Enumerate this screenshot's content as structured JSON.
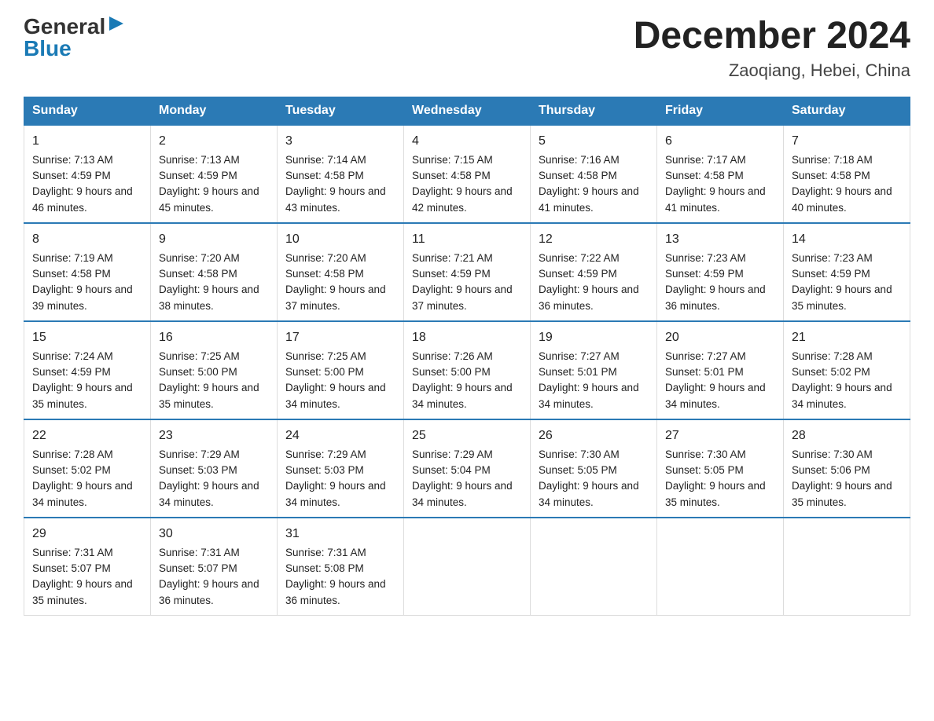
{
  "logo": {
    "general": "General",
    "blue": "Blue"
  },
  "title": "December 2024",
  "location": "Zaoqiang, Hebei, China",
  "weekdays": [
    "Sunday",
    "Monday",
    "Tuesday",
    "Wednesday",
    "Thursday",
    "Friday",
    "Saturday"
  ],
  "weeks": [
    [
      {
        "day": "1",
        "sunrise": "7:13 AM",
        "sunset": "4:59 PM",
        "daylight": "9 hours and 46 minutes."
      },
      {
        "day": "2",
        "sunrise": "7:13 AM",
        "sunset": "4:59 PM",
        "daylight": "9 hours and 45 minutes."
      },
      {
        "day": "3",
        "sunrise": "7:14 AM",
        "sunset": "4:58 PM",
        "daylight": "9 hours and 43 minutes."
      },
      {
        "day": "4",
        "sunrise": "7:15 AM",
        "sunset": "4:58 PM",
        "daylight": "9 hours and 42 minutes."
      },
      {
        "day": "5",
        "sunrise": "7:16 AM",
        "sunset": "4:58 PM",
        "daylight": "9 hours and 41 minutes."
      },
      {
        "day": "6",
        "sunrise": "7:17 AM",
        "sunset": "4:58 PM",
        "daylight": "9 hours and 41 minutes."
      },
      {
        "day": "7",
        "sunrise": "7:18 AM",
        "sunset": "4:58 PM",
        "daylight": "9 hours and 40 minutes."
      }
    ],
    [
      {
        "day": "8",
        "sunrise": "7:19 AM",
        "sunset": "4:58 PM",
        "daylight": "9 hours and 39 minutes."
      },
      {
        "day": "9",
        "sunrise": "7:20 AM",
        "sunset": "4:58 PM",
        "daylight": "9 hours and 38 minutes."
      },
      {
        "day": "10",
        "sunrise": "7:20 AM",
        "sunset": "4:58 PM",
        "daylight": "9 hours and 37 minutes."
      },
      {
        "day": "11",
        "sunrise": "7:21 AM",
        "sunset": "4:59 PM",
        "daylight": "9 hours and 37 minutes."
      },
      {
        "day": "12",
        "sunrise": "7:22 AM",
        "sunset": "4:59 PM",
        "daylight": "9 hours and 36 minutes."
      },
      {
        "day": "13",
        "sunrise": "7:23 AM",
        "sunset": "4:59 PM",
        "daylight": "9 hours and 36 minutes."
      },
      {
        "day": "14",
        "sunrise": "7:23 AM",
        "sunset": "4:59 PM",
        "daylight": "9 hours and 35 minutes."
      }
    ],
    [
      {
        "day": "15",
        "sunrise": "7:24 AM",
        "sunset": "4:59 PM",
        "daylight": "9 hours and 35 minutes."
      },
      {
        "day": "16",
        "sunrise": "7:25 AM",
        "sunset": "5:00 PM",
        "daylight": "9 hours and 35 minutes."
      },
      {
        "day": "17",
        "sunrise": "7:25 AM",
        "sunset": "5:00 PM",
        "daylight": "9 hours and 34 minutes."
      },
      {
        "day": "18",
        "sunrise": "7:26 AM",
        "sunset": "5:00 PM",
        "daylight": "9 hours and 34 minutes."
      },
      {
        "day": "19",
        "sunrise": "7:27 AM",
        "sunset": "5:01 PM",
        "daylight": "9 hours and 34 minutes."
      },
      {
        "day": "20",
        "sunrise": "7:27 AM",
        "sunset": "5:01 PM",
        "daylight": "9 hours and 34 minutes."
      },
      {
        "day": "21",
        "sunrise": "7:28 AM",
        "sunset": "5:02 PM",
        "daylight": "9 hours and 34 minutes."
      }
    ],
    [
      {
        "day": "22",
        "sunrise": "7:28 AM",
        "sunset": "5:02 PM",
        "daylight": "9 hours and 34 minutes."
      },
      {
        "day": "23",
        "sunrise": "7:29 AM",
        "sunset": "5:03 PM",
        "daylight": "9 hours and 34 minutes."
      },
      {
        "day": "24",
        "sunrise": "7:29 AM",
        "sunset": "5:03 PM",
        "daylight": "9 hours and 34 minutes."
      },
      {
        "day": "25",
        "sunrise": "7:29 AM",
        "sunset": "5:04 PM",
        "daylight": "9 hours and 34 minutes."
      },
      {
        "day": "26",
        "sunrise": "7:30 AM",
        "sunset": "5:05 PM",
        "daylight": "9 hours and 34 minutes."
      },
      {
        "day": "27",
        "sunrise": "7:30 AM",
        "sunset": "5:05 PM",
        "daylight": "9 hours and 35 minutes."
      },
      {
        "day": "28",
        "sunrise": "7:30 AM",
        "sunset": "5:06 PM",
        "daylight": "9 hours and 35 minutes."
      }
    ],
    [
      {
        "day": "29",
        "sunrise": "7:31 AM",
        "sunset": "5:07 PM",
        "daylight": "9 hours and 35 minutes."
      },
      {
        "day": "30",
        "sunrise": "7:31 AM",
        "sunset": "5:07 PM",
        "daylight": "9 hours and 36 minutes."
      },
      {
        "day": "31",
        "sunrise": "7:31 AM",
        "sunset": "5:08 PM",
        "daylight": "9 hours and 36 minutes."
      },
      null,
      null,
      null,
      null
    ]
  ]
}
